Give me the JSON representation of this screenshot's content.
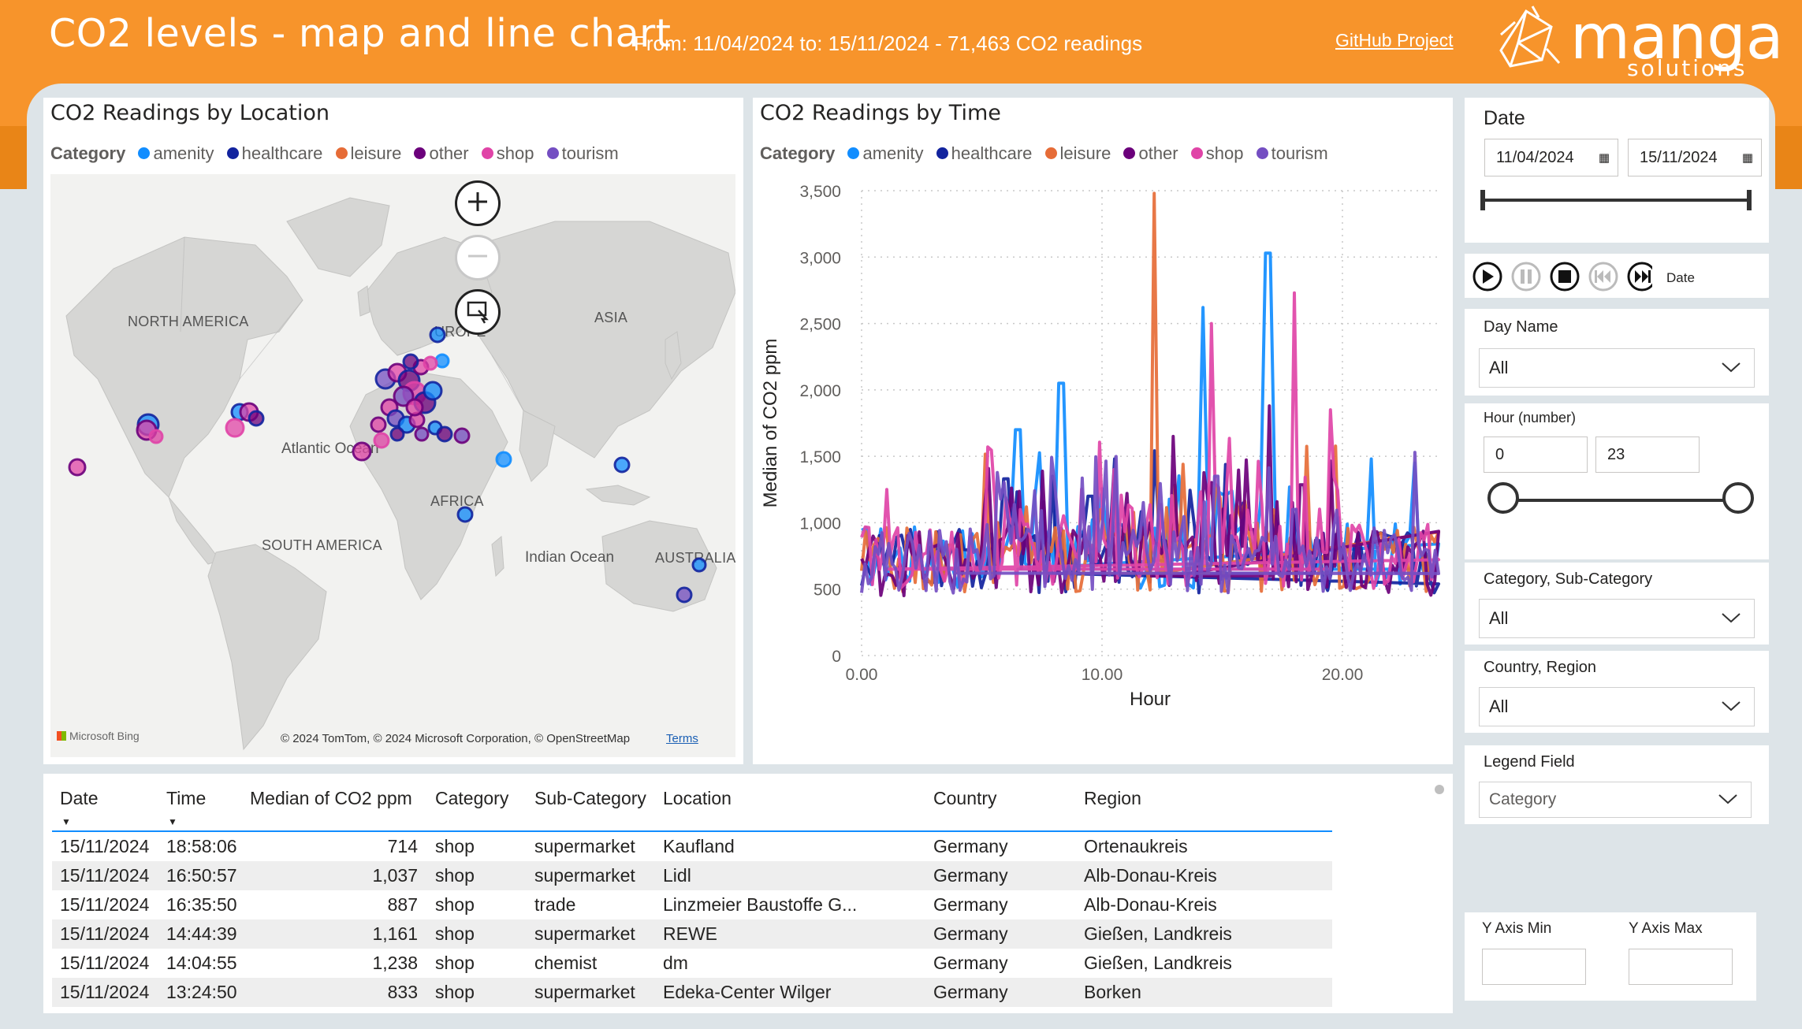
{
  "header": {
    "title": "CO2 levels - map and line chart",
    "subtitle": "From: 11/04/2024 to: 15/11/2024 - 71,463 CO2 readings",
    "github_link": "GitHub Project",
    "logo_text": "manga",
    "logo_sub": "solutions"
  },
  "colors": {
    "header": "#f7942b",
    "amenity": "#118dff",
    "healthcare": "#12239e",
    "leisure": "#e66c37",
    "other": "#6b007b",
    "shop": "#e044a7",
    "tourism": "#744ec2"
  },
  "legend": {
    "title": "Category",
    "items": [
      {
        "label": "amenity",
        "color": "#118dff"
      },
      {
        "label": "healthcare",
        "color": "#12239e"
      },
      {
        "label": "leisure",
        "color": "#e66c37"
      },
      {
        "label": "other",
        "color": "#6b007b"
      },
      {
        "label": "shop",
        "color": "#e044a7"
      },
      {
        "label": "tourism",
        "color": "#744ec2"
      }
    ]
  },
  "map_panel": {
    "title": "CO2 Readings by Location",
    "labels": {
      "north_america": "NORTH AMERICA",
      "europe": "UROPE",
      "asia": "ASIA",
      "atlantic": "Atlantic Ocean",
      "africa": "AFRICA",
      "south_america": "SOUTH AMERICA",
      "indian": "Indian Ocean",
      "australia": "AUSTRALIA"
    },
    "bing": "Microsoft Bing",
    "copyright": "© 2024 TomTom, © 2024 Microsoft Corporation, © OpenStreetMap",
    "terms": "Terms",
    "zoom_in_icon": "plus-icon",
    "zoom_out_icon": "minus-icon",
    "select_icon": "lasso-select-icon"
  },
  "chart_panel": {
    "title": "CO2 Readings by Time"
  },
  "chart_data": {
    "type": "line",
    "title": "CO2 Readings by Time",
    "xlabel": "Hour",
    "ylabel": "Median of CO2 ppm",
    "xlim": [
      0,
      24
    ],
    "ylim": [
      0,
      3500
    ],
    "x_ticks": [
      "0.00",
      "10.00",
      "20.00"
    ],
    "y_ticks": [
      "0",
      "500",
      "1,000",
      "1,500",
      "2,000",
      "2,500",
      "3,000",
      "3,500"
    ],
    "grid": "horizontal dotted",
    "legend_position": "top",
    "series": [
      {
        "name": "amenity",
        "color": "#118dff",
        "peaks": [
          [
            6.5,
            1700
          ],
          [
            8.3,
            2050
          ],
          [
            14.2,
            2620
          ],
          [
            16.9,
            3030
          ],
          [
            21.2,
            1480
          ],
          [
            23.0,
            1450
          ]
        ],
        "baseline": 650
      },
      {
        "name": "healthcare",
        "color": "#12239e",
        "peaks": [
          [
            8.0,
            1350
          ],
          [
            9.5,
            1200
          ],
          [
            13.0,
            1000
          ],
          [
            18.5,
            1000
          ]
        ],
        "baseline": 620
      },
      {
        "name": "leisure",
        "color": "#e66c37",
        "peaks": [
          [
            12.2,
            3480
          ],
          [
            10.0,
            1100
          ],
          [
            14.5,
            900
          ]
        ],
        "baseline": 620
      },
      {
        "name": "other",
        "color": "#6b007b",
        "peaks": [
          [
            13.0,
            1650
          ],
          [
            17.0,
            1880
          ],
          [
            12.0,
            1000
          ]
        ],
        "baseline": 600
      },
      {
        "name": "shop",
        "color": "#e044a7",
        "peaks": [
          [
            1.0,
            1250
          ],
          [
            14.5,
            2500
          ],
          [
            18.0,
            2730
          ],
          [
            19.5,
            1850
          ],
          [
            10.5,
            1400
          ]
        ],
        "baseline": 650
      },
      {
        "name": "tourism",
        "color": "#744ec2",
        "peaks": [
          [
            4.0,
            800
          ],
          [
            18.0,
            1100
          ],
          [
            23.0,
            1530
          ]
        ],
        "baseline": 620
      }
    ]
  },
  "table": {
    "columns": [
      "Date",
      "Time",
      "Median of CO2 ppm",
      "Category",
      "Sub-Category",
      "Location",
      "Country",
      "Region"
    ],
    "rows": [
      [
        "15/11/2024",
        "18:58:06",
        "714",
        "shop",
        "supermarket",
        "Kaufland",
        "Germany",
        "Ortenaukreis"
      ],
      [
        "15/11/2024",
        "16:50:57",
        "1,037",
        "shop",
        "supermarket",
        "Lidl",
        "Germany",
        "Alb-Donau-Kreis"
      ],
      [
        "15/11/2024",
        "16:35:50",
        "887",
        "shop",
        "trade",
        "Linzmeier Baustoffe G...",
        "Germany",
        "Alb-Donau-Kreis"
      ],
      [
        "15/11/2024",
        "14:44:39",
        "1,161",
        "shop",
        "supermarket",
        "REWE",
        "Germany",
        "Gießen, Landkreis"
      ],
      [
        "15/11/2024",
        "14:04:55",
        "1,238",
        "shop",
        "chemist",
        "dm",
        "Germany",
        "Gießen, Landkreis"
      ],
      [
        "15/11/2024",
        "13:24:50",
        "833",
        "shop",
        "supermarket",
        "Edeka-Center Wilger",
        "Germany",
        "Borken"
      ]
    ]
  },
  "slicers": {
    "date": {
      "title": "Date",
      "from": "11/04/2024",
      "to": "15/11/2024"
    },
    "player": {
      "label": "Date"
    },
    "day_name": {
      "title": "Day Name",
      "value": "All"
    },
    "hour": {
      "title": "Hour (number)",
      "min": "0",
      "max": "23"
    },
    "category": {
      "title": "Category, Sub-Category",
      "value": "All"
    },
    "country": {
      "title": "Country, Region",
      "value": "All"
    },
    "legend_field": {
      "title": "Legend Field",
      "value": "Category"
    },
    "y_axis": {
      "min_title": "Y Axis Min",
      "max_title": "Y Axis Max",
      "min_value": "",
      "max_value": ""
    }
  }
}
